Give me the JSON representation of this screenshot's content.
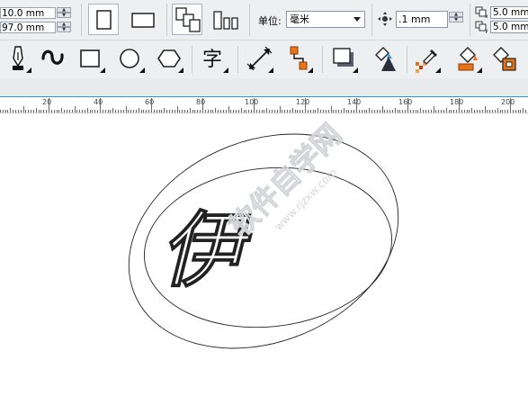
{
  "property_bar": {
    "width_value": "10.0 mm",
    "height_value": "97.0 mm",
    "unit_label": "单位:",
    "unit_value": "毫米",
    "nudge_value": ".1 mm",
    "dup_x_value": "5.0 mm",
    "dup_y_value": "5.0 mm",
    "buttons": {
      "portrait": "portrait-page-icon",
      "landscape": "landscape-page-icon",
      "all_pages": "all-pages-icon",
      "current_page": "current-page-icon",
      "nudge": "nudge-icon",
      "dup_x": "duplicate-x-icon",
      "dup_y": "duplicate-y-icon"
    }
  },
  "toolbox": {
    "tools": [
      "pen-tool-icon",
      "freehand-curve-icon",
      "rectangle-tool-icon",
      "ellipse-tool-icon",
      "polygon-tool-icon",
      "text-tool-icon",
      "dimension-tool-icon",
      "connector-tool-icon",
      "drop-shadow-tool-icon",
      "transparency-tool-icon",
      "color-eyedropper-icon",
      "fill-bucket-icon",
      "smart-fill-icon"
    ],
    "text_tool_glyph": "字"
  },
  "ruler": {
    "labels": [
      "20",
      "40",
      "60",
      "80",
      "100",
      "120",
      "140",
      "160",
      "180",
      "200"
    ]
  },
  "canvas": {
    "logo_glyph": "伊",
    "watermark_text": "软件自学网",
    "watermark_url": "www.rjzxw.com"
  },
  "colors": {
    "toolbar_bg": "#eeeff1",
    "ruler_accent": "#1ea1c0",
    "orange_accent": "#e8731a"
  }
}
